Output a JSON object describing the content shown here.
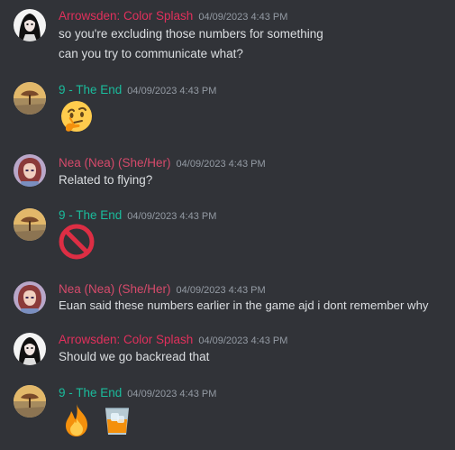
{
  "colors": {
    "background": "#313338",
    "text": "#dbdee1",
    "timestamp": "#949ba4",
    "arrowsden": "#e1305c",
    "the_end": "#1abc9c",
    "nea": "#d64a6b"
  },
  "messages": [
    {
      "author": "Arrowsden: Color Splash",
      "timestamp": "04/09/2023 4:43 PM",
      "lines": [
        "so you're excluding those numbers for something",
        "can you try to communicate what?"
      ]
    },
    {
      "author": "9 - The End",
      "timestamp": "04/09/2023 4:43 PM",
      "emoji": [
        "thinking-face"
      ]
    },
    {
      "author": "Nea (Nea) (She/Her)",
      "timestamp": "04/09/2023 4:43 PM",
      "lines": [
        "Related to flying?"
      ]
    },
    {
      "author": "9 - The End",
      "timestamp": "04/09/2023 4:43 PM",
      "emoji": [
        "no-entry-sign"
      ]
    },
    {
      "author": "Nea (Nea) (She/Her)",
      "timestamp": "04/09/2023 4:43 PM",
      "lines": [
        "Euan said these numbers earlier in the game ajd i dont remember why"
      ]
    },
    {
      "author": "Arrowsden: Color Splash",
      "timestamp": "04/09/2023 4:43 PM",
      "lines": [
        "Should we go backread that"
      ]
    },
    {
      "author": "9 - The End",
      "timestamp": "04/09/2023 4:43 PM",
      "emoji": [
        "fire",
        "tumbler-glass"
      ]
    }
  ]
}
